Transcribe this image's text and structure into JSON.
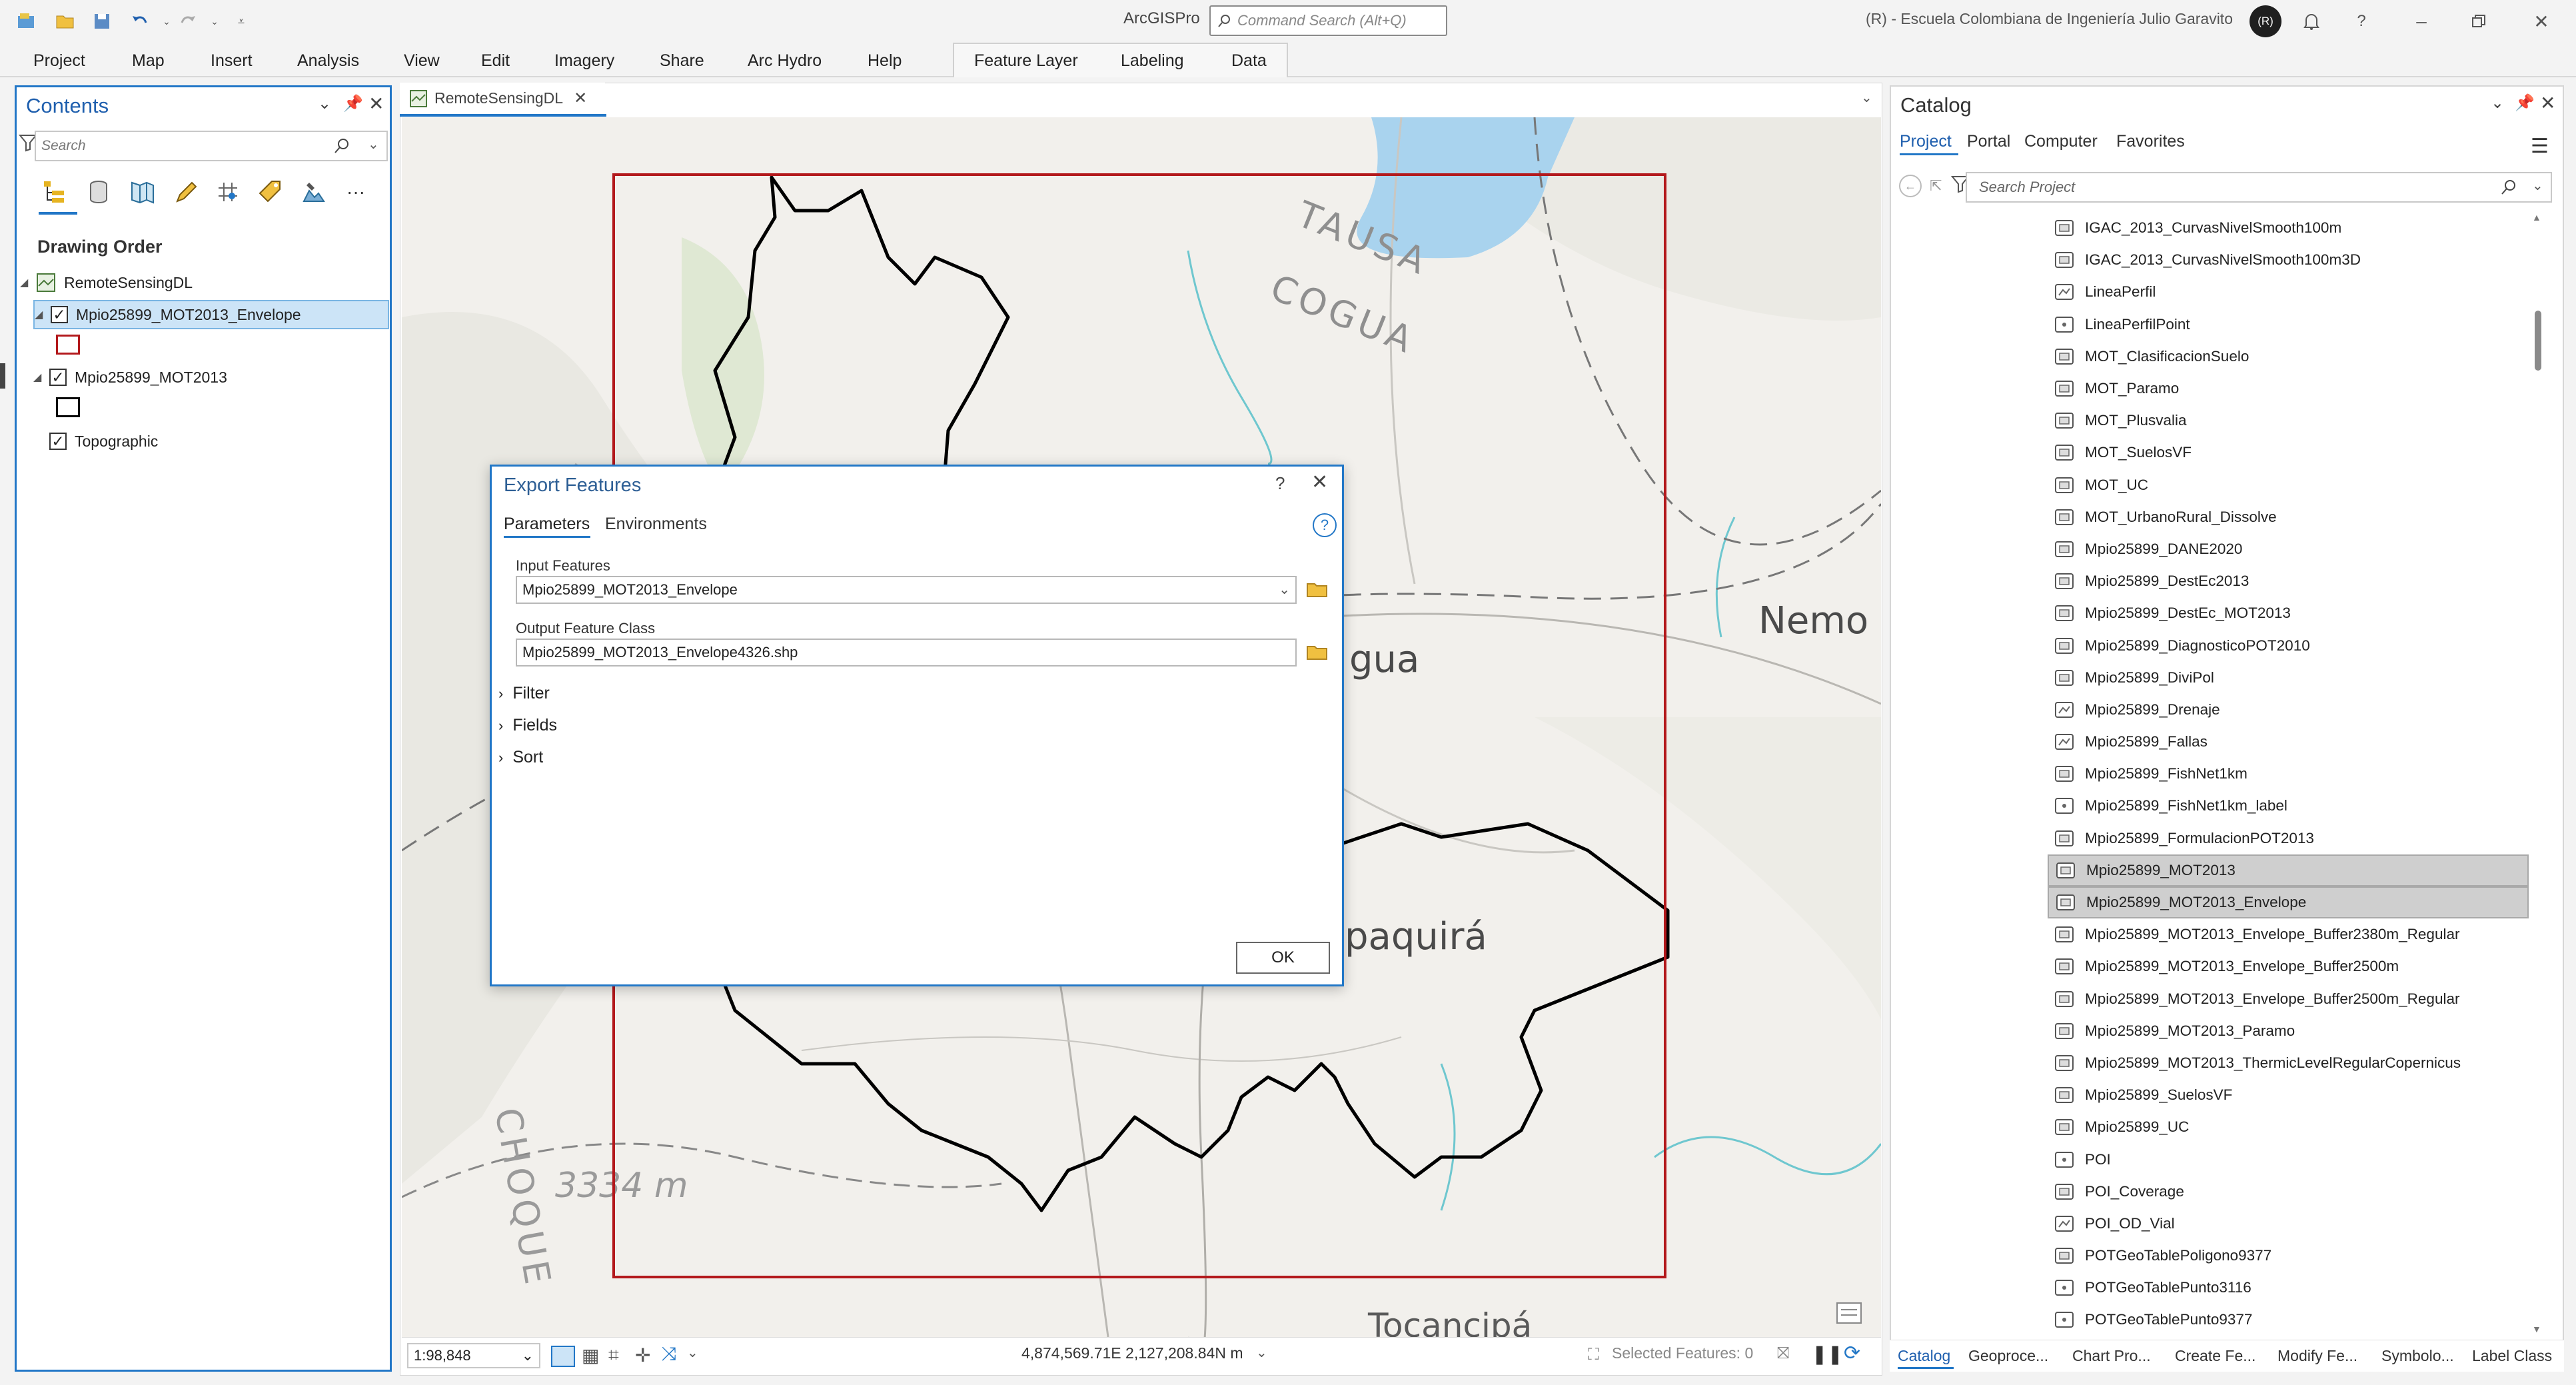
{
  "app": {
    "title": "ArcGISPro",
    "command_search_placeholder": "Command Search (Alt+Q)",
    "organization": "(R) - Escuela Colombiana de Ingeniería Julio Garavito",
    "avatar_initials": "(R)"
  },
  "ribbon": {
    "tabs": [
      "Project",
      "Map",
      "Insert",
      "Analysis",
      "View",
      "Edit",
      "Imagery",
      "Share",
      "Arc Hydro",
      "Help"
    ],
    "contextual_tabs": [
      "Feature Layer",
      "Labeling",
      "Data"
    ]
  },
  "contents": {
    "title": "Contents",
    "search_placeholder": "Search",
    "section": "Drawing Order",
    "map_name": "RemoteSensingDL",
    "layers": [
      {
        "name": "Mpio25899_MOT2013_Envelope",
        "checked": true,
        "selected": true,
        "symbol_color": "#b3191c"
      },
      {
        "name": "Mpio25899_MOT2013",
        "checked": true,
        "selected": false,
        "symbol_color": "#000000"
      },
      {
        "name": "Topographic",
        "checked": true,
        "selected": false
      }
    ]
  },
  "map": {
    "tab": "RemoteSensingDL",
    "labels": {
      "place1": "TAUSA",
      "place2": "COGUA",
      "place3": "gua",
      "place4": "Nemo",
      "place5": "paquirá",
      "place6": "CHOQUE",
      "elevation": "3334 m",
      "place7": "Tocancipá"
    },
    "status": {
      "scale": "1:98,848",
      "coordinates": "4,874,569.71E 2,127,208.84N m",
      "selected_features": "Selected Features: 0"
    }
  },
  "dialog": {
    "title": "Export Features",
    "help": "?",
    "tabs": [
      "Parameters",
      "Environments"
    ],
    "input_label": "Input Features",
    "input_value": "Mpio25899_MOT2013_Envelope",
    "output_label": "Output Feature Class",
    "output_value": "Mpio25899_MOT2013_Envelope4326.shp",
    "sections": [
      "Filter",
      "Fields",
      "Sort"
    ],
    "ok": "OK"
  },
  "catalog": {
    "title": "Catalog",
    "tabs": [
      "Project",
      "Portal",
      "Computer",
      "Favorites"
    ],
    "search_placeholder": "Search Project",
    "items": [
      {
        "name": "IGAC_2013_CurvasNivelSmooth100m",
        "type": "poly"
      },
      {
        "name": "IGAC_2013_CurvasNivelSmooth100m3D",
        "type": "poly"
      },
      {
        "name": "LineaPerfil",
        "type": "line"
      },
      {
        "name": "LineaPerfilPoint",
        "type": "point"
      },
      {
        "name": "MOT_ClasificacionSuelo",
        "type": "poly"
      },
      {
        "name": "MOT_Paramo",
        "type": "poly"
      },
      {
        "name": "MOT_Plusvalia",
        "type": "poly"
      },
      {
        "name": "MOT_SuelosVF",
        "type": "poly"
      },
      {
        "name": "MOT_UC",
        "type": "poly"
      },
      {
        "name": "MOT_UrbanoRural_Dissolve",
        "type": "poly"
      },
      {
        "name": "Mpio25899_DANE2020",
        "type": "poly"
      },
      {
        "name": "Mpio25899_DestEc2013",
        "type": "poly"
      },
      {
        "name": "Mpio25899_DestEc_MOT2013",
        "type": "poly"
      },
      {
        "name": "Mpio25899_DiagnosticoPOT2010",
        "type": "poly"
      },
      {
        "name": "Mpio25899_DiviPol",
        "type": "poly"
      },
      {
        "name": "Mpio25899_Drenaje",
        "type": "line"
      },
      {
        "name": "Mpio25899_Fallas",
        "type": "line"
      },
      {
        "name": "Mpio25899_FishNet1km",
        "type": "poly"
      },
      {
        "name": "Mpio25899_FishNet1km_label",
        "type": "point"
      },
      {
        "name": "Mpio25899_FormulacionPOT2013",
        "type": "poly"
      },
      {
        "name": "Mpio25899_MOT2013",
        "type": "poly",
        "selected": true
      },
      {
        "name": "Mpio25899_MOT2013_Envelope",
        "type": "poly",
        "selected": true
      },
      {
        "name": "Mpio25899_MOT2013_Envelope_Buffer2380m_Regular",
        "type": "poly"
      },
      {
        "name": "Mpio25899_MOT2013_Envelope_Buffer2500m",
        "type": "poly"
      },
      {
        "name": "Mpio25899_MOT2013_Envelope_Buffer2500m_Regular",
        "type": "poly"
      },
      {
        "name": "Mpio25899_MOT2013_Paramo",
        "type": "poly"
      },
      {
        "name": "Mpio25899_MOT2013_ThermicLevelRegularCopernicus",
        "type": "poly"
      },
      {
        "name": "Mpio25899_SuelosVF",
        "type": "poly"
      },
      {
        "name": "Mpio25899_UC",
        "type": "poly"
      },
      {
        "name": "POI",
        "type": "point"
      },
      {
        "name": "POI_Coverage",
        "type": "poly"
      },
      {
        "name": "POI_OD_Vial",
        "type": "line"
      },
      {
        "name": "POTGeoTablePoligono9377",
        "type": "poly"
      },
      {
        "name": "POTGeoTablePunto3116",
        "type": "point"
      },
      {
        "name": "POTGeoTablePunto9377",
        "type": "point"
      }
    ],
    "bottom_tabs": [
      "Catalog",
      "Geoproce...",
      "Chart Pro...",
      "Create Fe...",
      "Modify Fe...",
      "Symbolo...",
      "Label Class"
    ]
  },
  "colors": {
    "accent": "#2277c7",
    "envelope": "#b3191c",
    "water": "#a9d3ee",
    "selection": "#cfcfcf"
  }
}
